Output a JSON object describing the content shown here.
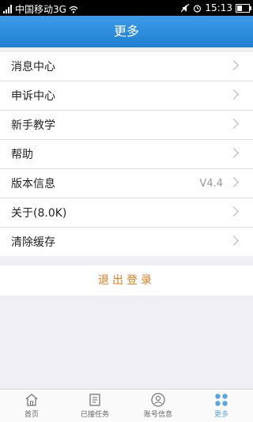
{
  "status_bar": {
    "carrier": "中国移动3G",
    "time": "15:13",
    "icons": [
      "signal-icon",
      "wifi-icon",
      "mute-icon",
      "alarm-icon",
      "battery-icon"
    ]
  },
  "header": {
    "title": "更多"
  },
  "menu": {
    "items": [
      {
        "label": "消息中心",
        "value": ""
      },
      {
        "label": "申诉中心",
        "value": ""
      },
      {
        "label": "新手教学",
        "value": ""
      },
      {
        "label": "帮助",
        "value": ""
      },
      {
        "label": "版本信息",
        "value": "V4.4"
      },
      {
        "label": "关于(8.0K)",
        "value": ""
      },
      {
        "label": "清除缓存",
        "value": ""
      }
    ]
  },
  "logout": {
    "label": "退出登录"
  },
  "tabbar": {
    "tabs": [
      {
        "label": "首页",
        "icon": "home-icon"
      },
      {
        "label": "已接任务",
        "icon": "task-icon"
      },
      {
        "label": "账号信息",
        "icon": "user-icon"
      },
      {
        "label": "更多",
        "icon": "more-icon",
        "active": true
      }
    ]
  },
  "colors": {
    "accent": "#1f7fd1",
    "logout": "#e07b1c",
    "active_tab": "#5aa7e0"
  }
}
